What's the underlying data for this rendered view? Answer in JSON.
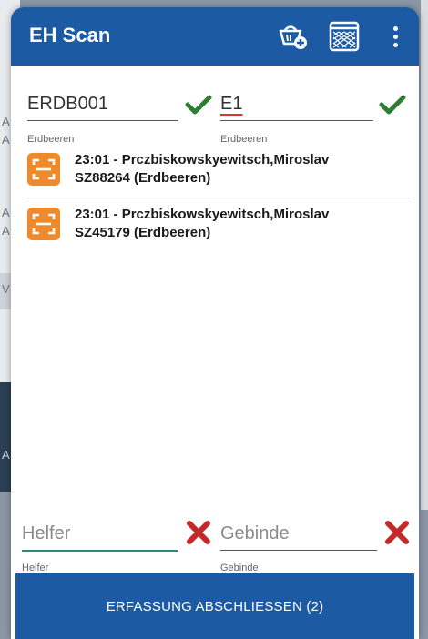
{
  "background": {
    "letters": [
      "A",
      "A",
      "A",
      "A",
      "V",
      "A"
    ]
  },
  "appbar": {
    "title": "EH Scan",
    "basket_icon": "basket-add-icon",
    "net_icon": "net-icon",
    "more_icon": "more-vert-icon",
    "color": "#1c5aa3"
  },
  "fields": {
    "top_left": {
      "value": "ERDB001",
      "caption": "Erdbeeren",
      "status": "valid"
    },
    "top_right": {
      "value": "E1",
      "caption": "Erdbeeren",
      "status": "valid"
    },
    "bottom_left": {
      "placeholder": "Helfer",
      "caption": "Helfer",
      "status": "invalid"
    },
    "bottom_right": {
      "placeholder": "Gebinde",
      "caption": "Gebinde",
      "status": "invalid"
    }
  },
  "entries": [
    {
      "line1": "23:01 - Prczbiskowskyewitsch,Miroslav",
      "line2": "SZ88264 (Erdbeeren)",
      "icon": "scan-icon"
    },
    {
      "line1": "23:01 - Prczbiskowskyewitsch,Miroslav",
      "line2": "SZ45179 (Erdbeeren)",
      "icon": "scan-icon"
    }
  ],
  "footer": {
    "label": "ERFASSUNG ABSCHLIESSEN (2)"
  },
  "colors": {
    "accent": "#1c5aa3",
    "check": "#2e7d32",
    "cross": "#c62828",
    "scan_badge": "#ef8a2c",
    "focus_underline": "#2e8b7a"
  }
}
